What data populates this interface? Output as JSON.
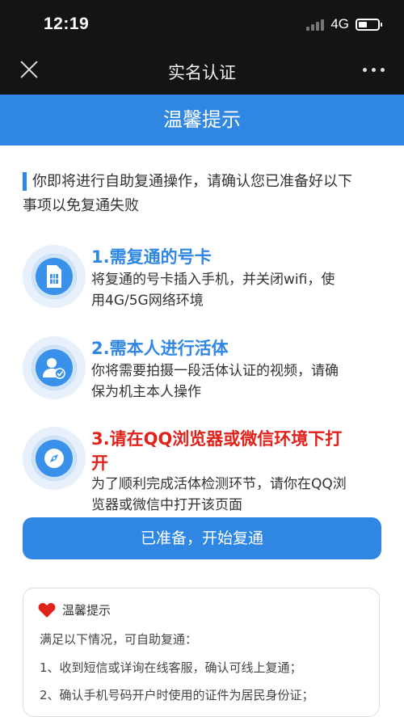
{
  "status_bar": {
    "time": "12:19",
    "network": "4G"
  },
  "nav": {
    "title": "实名认证"
  },
  "hero": {
    "title": "温馨提示"
  },
  "intro": {
    "line1": "你即将进行自助复通操作，请确认您已准备好以下",
    "line2": "事项以免复通失败"
  },
  "steps": [
    {
      "title": "1.需复通的号卡",
      "desc_line1": "将复通的号卡插入手机，并关闭wifi，使",
      "desc_line2": "用4G/5G网络环境",
      "icon": "sim-card-icon"
    },
    {
      "title": "2.需本人进行活体",
      "desc_line1": "你将需要拍摄一段活体认证的视频，请确",
      "desc_line2": "保为机主本人操作",
      "icon": "user-verify-icon"
    },
    {
      "title_line1": "3.请在QQ浏览器或微信环境下打",
      "title_line2": "开",
      "desc_line1": "为了顺利完成活体检测环节，请你在QQ浏",
      "desc_line2": "览器或微信中打开该页面",
      "icon": "compass-icon"
    }
  ],
  "primary_button": {
    "label": "已准备，开始复通"
  },
  "tips_card": {
    "title": "温馨提示",
    "intro": "满足以下情况，可自助复通：",
    "items": [
      "1、收到短信或详询在线客服，确认可线上复通；",
      "2、确认手机号码开户时使用的证件为居民身份证；"
    ]
  },
  "colors": {
    "accent": "#2f87e3",
    "warning_title": "#e0221b",
    "topbar": "#141414"
  }
}
